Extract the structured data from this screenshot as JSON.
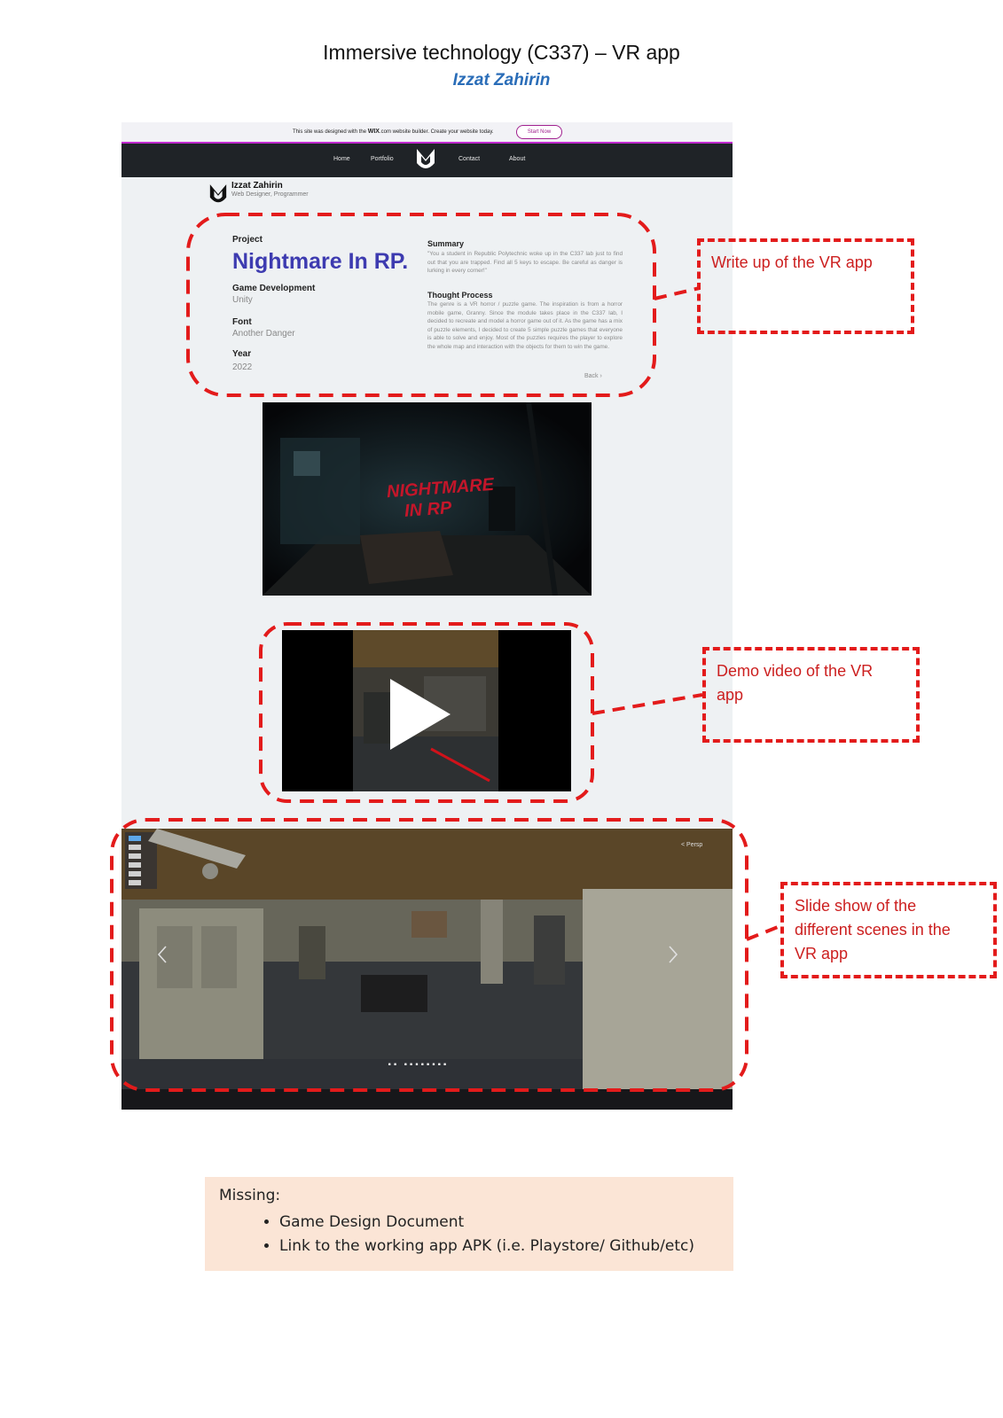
{
  "document": {
    "title": "Immersive technology (C337) – VR app",
    "author": "Izzat Zahirin"
  },
  "site": {
    "wix_bar": {
      "message_before": "This site was designed with the ",
      "brand": "WIX",
      "message_after": ".com website builder. Create your website today.",
      "button": "Start Now"
    },
    "nav": {
      "home": "Home",
      "portfolio": "Portfolio",
      "contact": "Contact",
      "about": "About"
    },
    "brand": {
      "name": "Izzat Zahirin",
      "subtitle": "Web Designer, Programmer"
    },
    "project": {
      "label": "Project",
      "name": "Nightmare In RP.",
      "category_label": "Game Development",
      "category_value": "Unity",
      "font_label": "Font",
      "font_value": "Another Danger",
      "year_label": "Year",
      "year_value": "2022",
      "summary_label": "Summary",
      "summary_text": "\"You a student in Republic Polytechnic woke up in the C337 lab just to find out that you are trapped. Find all 5 keys to escape. Be careful as danger is lurking in every corner!\"",
      "thought_label": "Thought Process",
      "thought_text": "The genre is a VR horror / puzzle game. The inspiration is from a horror mobile game, Granny. Since the module takes place in the C337 lab, I decided to recreate and model a horror game out of it. As the game has a mix of puzzle elements, I decided to create 5 simple puzzle games that everyone is able to solve and enjoy. Most of the puzzles requires the player to explore the whole map and interaction with the objects for them to win the game.",
      "back": "Back ›"
    },
    "banner_text_line1": "NIGHTMARE",
    "banner_text_line2": "IN RP",
    "slideshow": {
      "persp_label": "< Persp",
      "dots": "·· ········"
    }
  },
  "annotations": {
    "writeup": "Write up of the VR app",
    "demo": "Demo video of the VR\napp",
    "slideshow": "Slide show of the\ndifferent scenes in the\nVR app"
  },
  "missing": {
    "heading": "Missing:",
    "items": [
      "Game Design Document",
      "Link to the working app APK (i.e. Playstore/ Github/etc)"
    ]
  },
  "colors": {
    "annotation_red": "#e31b1b",
    "project_title_blue": "#3d3bb0",
    "author_blue": "#2a6db8",
    "missing_bg": "#fbe5d6",
    "nav_dark": "#1f2327"
  }
}
